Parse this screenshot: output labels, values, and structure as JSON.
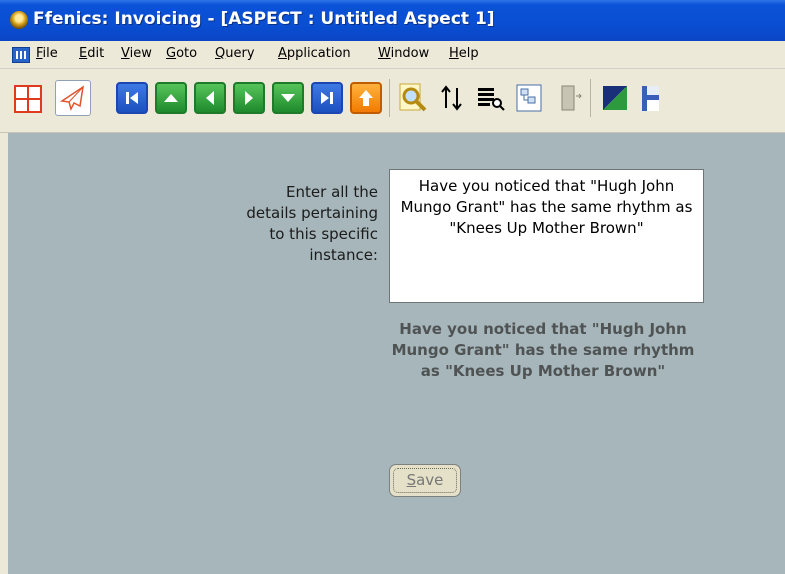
{
  "window": {
    "title": "Ffenics: Invoicing - [ASPECT : Untitled Aspect 1]"
  },
  "menu": [
    {
      "label": "File",
      "accel": "F",
      "rest": "ile"
    },
    {
      "label": "Edit",
      "accel": "E",
      "rest": "dit"
    },
    {
      "label": "View",
      "accel": "V",
      "rest": "iew"
    },
    {
      "label": "Goto",
      "accel": "G",
      "rest": "oto"
    },
    {
      "label": "Query",
      "accel": "Q",
      "rest": "uery"
    },
    {
      "label": "Application",
      "accel": "A",
      "rest": "pplication"
    },
    {
      "label": "Window",
      "accel": "W",
      "rest": "indow"
    },
    {
      "label": "Help",
      "accel": "H",
      "rest": "elp"
    }
  ],
  "toolbar": {
    "icons": [
      "grid-layout-icon",
      "paper-plane-icon",
      "first-record-icon",
      "up-arrow-icon",
      "previous-record-icon",
      "next-record-icon",
      "down-arrow-icon",
      "last-record-icon",
      "upload-icon",
      "find-icon",
      "sort-icon",
      "list-search-icon",
      "tree-icon",
      "exit-icon",
      "edit-icon",
      "save-disk-icon"
    ],
    "colors": {
      "blue": "#1c50c0",
      "green": "#1e8a2d",
      "orange": "#f27b00"
    }
  },
  "form": {
    "prompt_lines": [
      "Enter all the",
      "details pertaining",
      "to this specific",
      "instance:"
    ],
    "input_value": "Have you noticed that \"Hugh John Mungo Grant\" has the same rhythm as \"Knees Up Mother Brown\"",
    "echo_text": "Have you noticed that \"Hugh John Mungo Grant\" has the same rhythm as \"Knees Up Mother Brown\"",
    "save": {
      "accel": "S",
      "rest": "ave"
    }
  }
}
